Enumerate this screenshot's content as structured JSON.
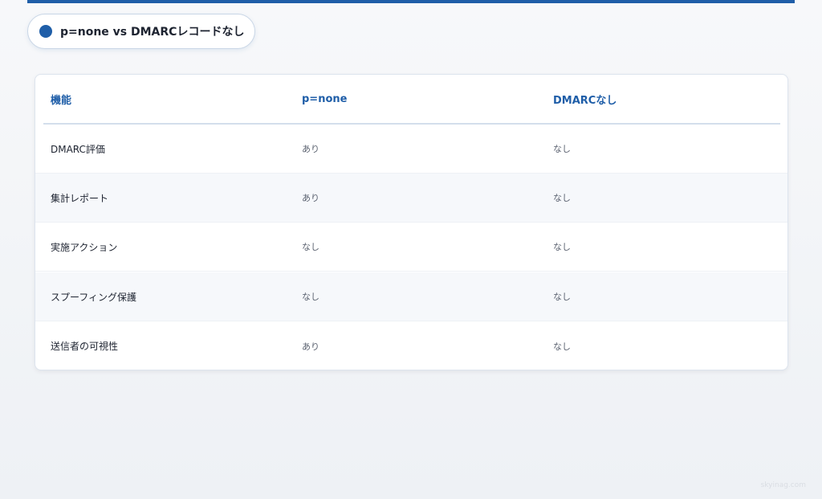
{
  "title": {
    "text": "p=none vs DMARCレコードなし"
  },
  "table": {
    "headers": [
      "機能",
      "p=none",
      "DMARCなし"
    ],
    "rows": [
      {
        "feature": "DMARC評価",
        "p_none": "あり",
        "no_dmarc": "なし"
      },
      {
        "feature": "集計レポート",
        "p_none": "あり",
        "no_dmarc": "なし"
      },
      {
        "feature": "実施アクション",
        "p_none": "なし",
        "no_dmarc": "なし"
      },
      {
        "feature": "スプーフィング保護",
        "p_none": "なし",
        "no_dmarc": "なし"
      },
      {
        "feature": "送信者の可視性",
        "p_none": "あり",
        "no_dmarc": "なし"
      }
    ]
  },
  "watermark": "skyinag.com",
  "colors": {
    "accent": "#1f5ea8",
    "text": "#1d2330",
    "muted": "#5b6270",
    "alt_row": "#f6f8fb"
  }
}
